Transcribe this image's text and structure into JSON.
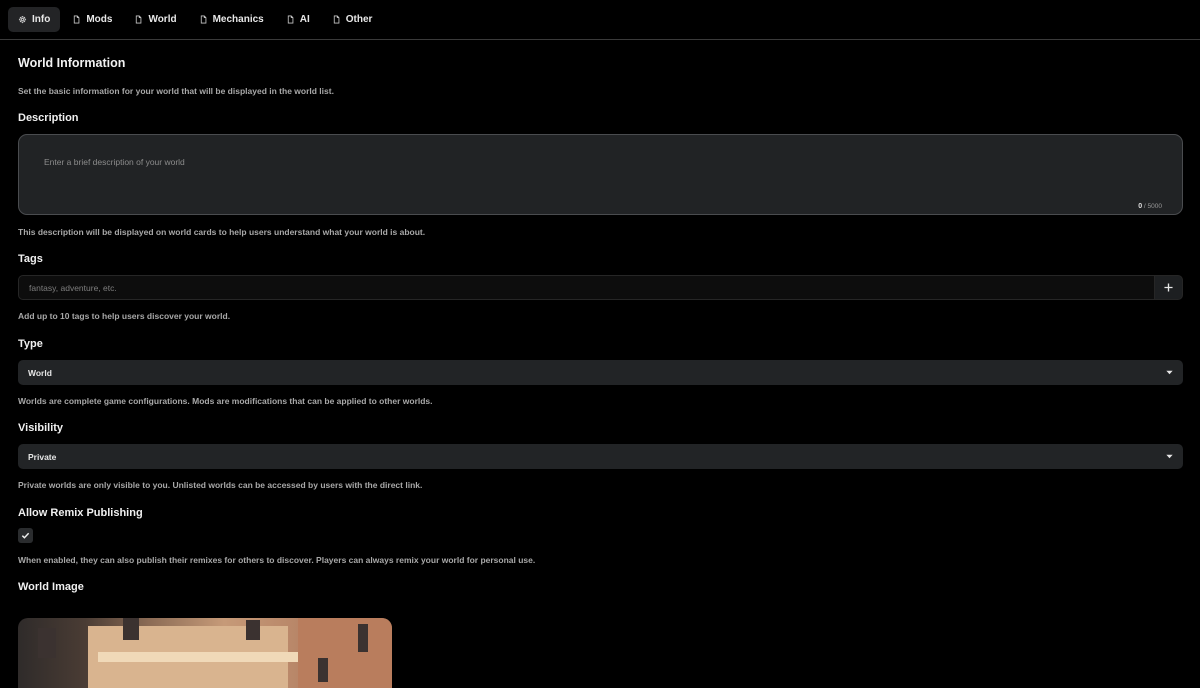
{
  "tabs": [
    {
      "label": "Info",
      "icon": "gear-icon",
      "active": true
    },
    {
      "label": "Mods",
      "icon": "file-icon",
      "active": false
    },
    {
      "label": "World",
      "icon": "file-icon",
      "active": false
    },
    {
      "label": "Mechanics",
      "icon": "file-icon",
      "active": false
    },
    {
      "label": "AI",
      "icon": "file-icon",
      "active": false
    },
    {
      "label": "Other",
      "icon": "file-icon",
      "active": false
    }
  ],
  "section": {
    "title": "World Information",
    "subtitle": "Set the basic information for your world that will be displayed in the world list."
  },
  "description": {
    "label": "Description",
    "placeholder": "Enter a brief description of your world",
    "count": "0",
    "max": "/ 5000",
    "help": "This description will be displayed on world cards to help users understand what your world is about."
  },
  "tags": {
    "label": "Tags",
    "placeholder": "fantasy, adventure, etc.",
    "add_icon": "plus-icon",
    "help": "Add up to 10 tags to help users discover your world."
  },
  "type": {
    "label": "Type",
    "value": "World",
    "help": "Worlds are complete game configurations. Mods are modifications that can be applied to other worlds."
  },
  "visibility": {
    "label": "Visibility",
    "value": "Private",
    "help": "Private worlds are only visible to you. Unlisted worlds can be accessed by users with the direct link."
  },
  "remix": {
    "label": "Allow Remix Publishing",
    "checked": true,
    "help": "When enabled, they can also publish their remixes for others to discover. Players can always remix your world for personal use."
  },
  "world_image": {
    "label": "World Image"
  }
}
